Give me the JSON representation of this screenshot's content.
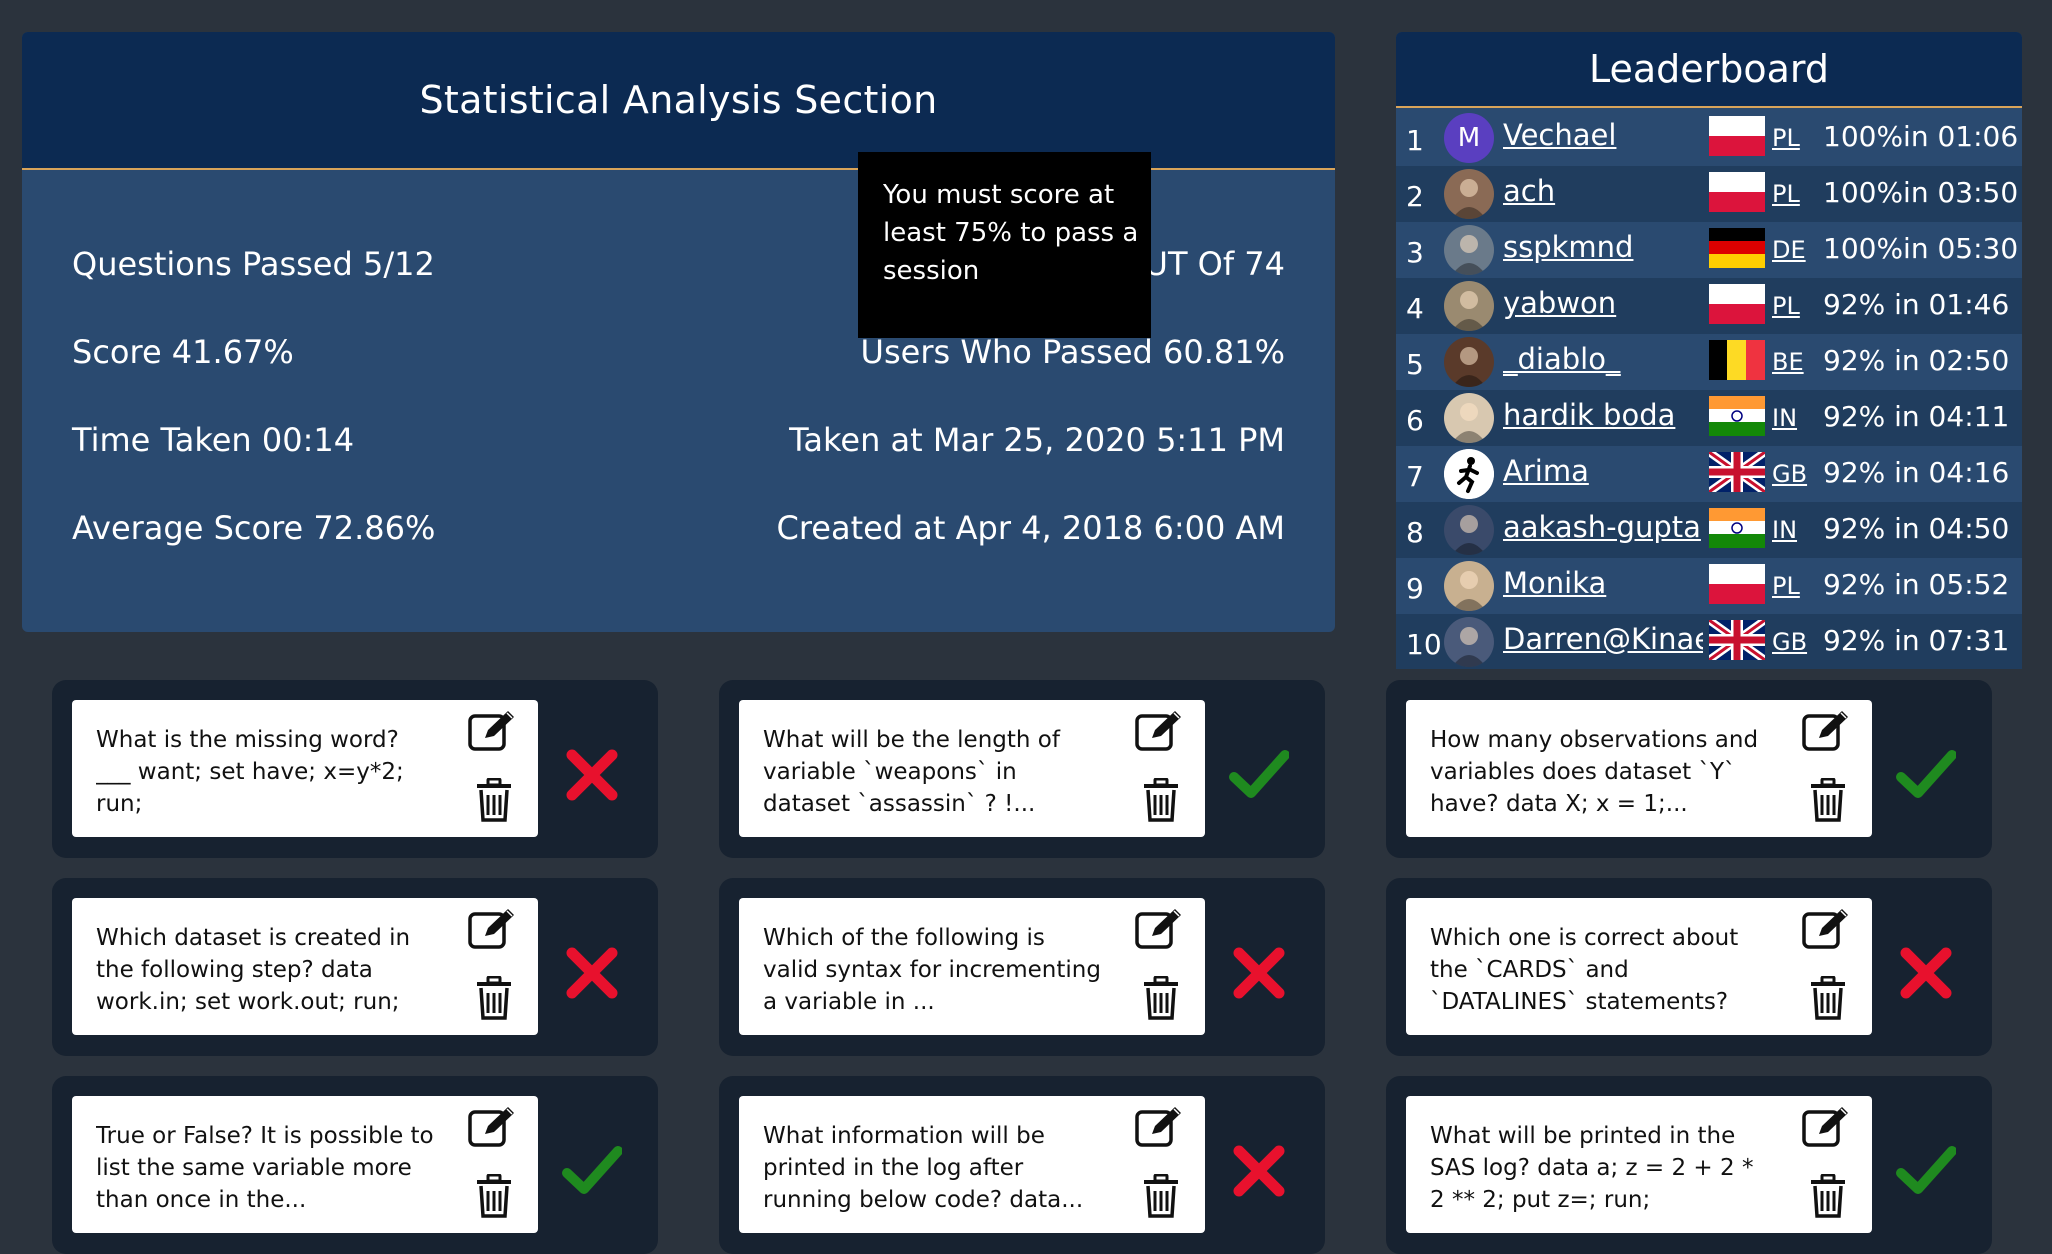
{
  "stats": {
    "title": "Statistical Analysis Section",
    "questions_passed": "Questions Passed 5/12",
    "rank_partial": "UT Of 74",
    "score": "Score 41.67%",
    "users_passed": "Users Who Passed 60.81%",
    "time_taken": "Time Taken 00:14",
    "taken_at": "Taken at Mar 25, 2020 5:11 PM",
    "average_score": "Average Score 72.86%",
    "created_at": "Created at Apr 4, 2018 6:00 AM",
    "tooltip": "You must score at least 75% to pass a session"
  },
  "leaderboard": {
    "title": "Leaderboard",
    "rows": [
      {
        "rank": "1",
        "name": "Vechael",
        "avatar": "M",
        "country": "PL",
        "score": "100%in 01:06"
      },
      {
        "rank": "2",
        "name": "ach",
        "country": "PL",
        "score": "100%in 03:50"
      },
      {
        "rank": "3",
        "name": "sspkmnd",
        "country": "DE",
        "score": "100%in 05:30"
      },
      {
        "rank": "4",
        "name": "yabwon",
        "country": "PL",
        "score": "92% in 01:46"
      },
      {
        "rank": "5",
        "name": "_diablo_",
        "country": "BE",
        "score": "92% in 02:50"
      },
      {
        "rank": "6",
        "name": "hardik boda",
        "country": "IN",
        "score": "92% in 04:11"
      },
      {
        "rank": "7",
        "name": "Arima",
        "country": "GB",
        "score": "92% in 04:16"
      },
      {
        "rank": "8",
        "name": "aakash-gupta",
        "country": "IN",
        "score": "92% in 04:50"
      },
      {
        "rank": "9",
        "name": "Monika",
        "country": "PL",
        "score": "92% in 05:52"
      },
      {
        "rank": "10",
        "name": "Darren@Kinae",
        "country": "GB",
        "score": "92% in 07:31"
      }
    ]
  },
  "questions": [
    {
      "text": "What is the missing word? ___ want; set have; x=y*2; run;",
      "status": "wrong"
    },
    {
      "text": "What will be the length of variable `weapons` in dataset `assassin` ? !...",
      "status": "correct"
    },
    {
      "text": "How many observations and variables does dataset `Y` have? data X; x = 1;...",
      "status": "correct"
    },
    {
      "text": "Which dataset is created in the following step? data work.in; set work.out; run;",
      "status": "wrong"
    },
    {
      "text": "Which of the following is valid syntax for incrementing a variable in ...",
      "status": "wrong"
    },
    {
      "text": "Which one is correct about the `CARDS` and `DATALINES` statements?",
      "status": "wrong"
    },
    {
      "text": "True or False? It is possible to list the same variable more than once in the...",
      "status": "correct"
    },
    {
      "text": "What information will be printed in the log after running below code? data...",
      "status": "wrong"
    },
    {
      "text": "What will be printed in the SAS log? data a; z = 2 + 2 * 2 ** 2; put z=; run;",
      "status": "correct"
    }
  ],
  "icons": {
    "edit": "pencil-square-icon",
    "delete": "trash-icon",
    "correct": "check-icon",
    "wrong": "cross-icon"
  },
  "colors": {
    "correct": "#1f8a1f",
    "wrong": "#e8112d",
    "panel": "#2a4a70",
    "header": "#0c2a52",
    "accent": "#d9a45a"
  }
}
